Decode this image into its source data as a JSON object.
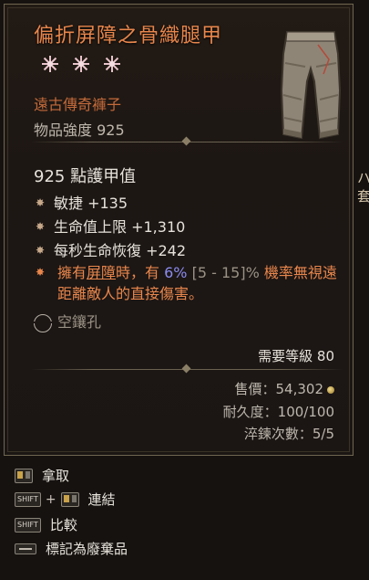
{
  "item": {
    "name": "偏折屏障之骨織腿甲",
    "rarity_stars": 3,
    "subtype": "遠古傳奇褲子",
    "power": "物品強度 925",
    "armor": "925 點護甲值",
    "affixes": [
      {
        "text": "敏捷 +135"
      },
      {
        "text": "生命值上限 +1,310"
      },
      {
        "text": "每秒生命恢復 +242"
      }
    ],
    "legendary": {
      "part1": "擁有",
      "keyword": "屏障",
      "part2": "時，有 ",
      "value": "6%",
      "range": " [5 - 15]%",
      "part3": " 機率無視遠距離敵人的直接傷害。"
    },
    "socket": "空鑲孔",
    "required_level": "需要等級 80",
    "sell_value": "售價：54,302",
    "durability": "耐久度：100/100",
    "temper": "淬鍊次數：5/5"
  },
  "controls": {
    "pickup": "拿取",
    "shift_label": "SHIFT",
    "link": "連結",
    "compare": "比較",
    "junk": "標記為廢棄品"
  },
  "colors": {
    "legendary_orange": "#e8864c",
    "value_blue": "#8c8cf0",
    "text_light": "#e6e2da",
    "border": "#6f6650"
  },
  "icons": {
    "rarity": "snowflake-star-icon",
    "affix_bullet": "star-bullet-icon",
    "socket": "empty-socket-icon",
    "coin": "gold-coin-icon",
    "mouse": "mouse-left-icon",
    "shift": "shift-key-icon",
    "space": "space-key-icon",
    "item": "pants-icon"
  },
  "edge_text": "ハ 套"
}
